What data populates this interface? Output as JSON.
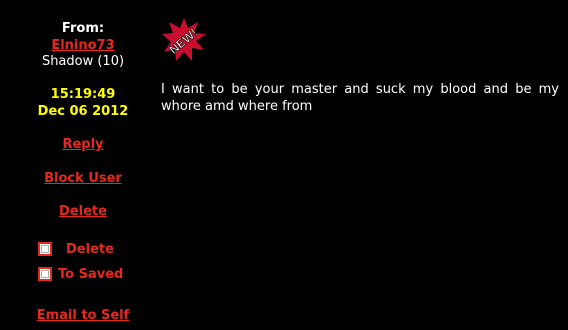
{
  "sender": {
    "from_label": "From:",
    "username": "Elnino73",
    "rank": "Shadow (10)",
    "time": "15:19:49",
    "date": "Dec 06 2012"
  },
  "actions": {
    "reply": "Reply",
    "block_user": "Block User",
    "delete": "Delete",
    "email_to_self": "Email to Self"
  },
  "checkboxes": {
    "delete_label": "Delete",
    "to_saved_label": "To Saved"
  },
  "badge": {
    "text": "NEW!",
    "icon": "new-starburst-icon",
    "color": "#c8102e"
  },
  "message": {
    "body": "I want to be your master and suck my blood and be my whore amd where from"
  },
  "colors": {
    "background": "#000000",
    "link": "#e8281b",
    "timestamp": "#ffff00",
    "text": "#ffffff"
  }
}
